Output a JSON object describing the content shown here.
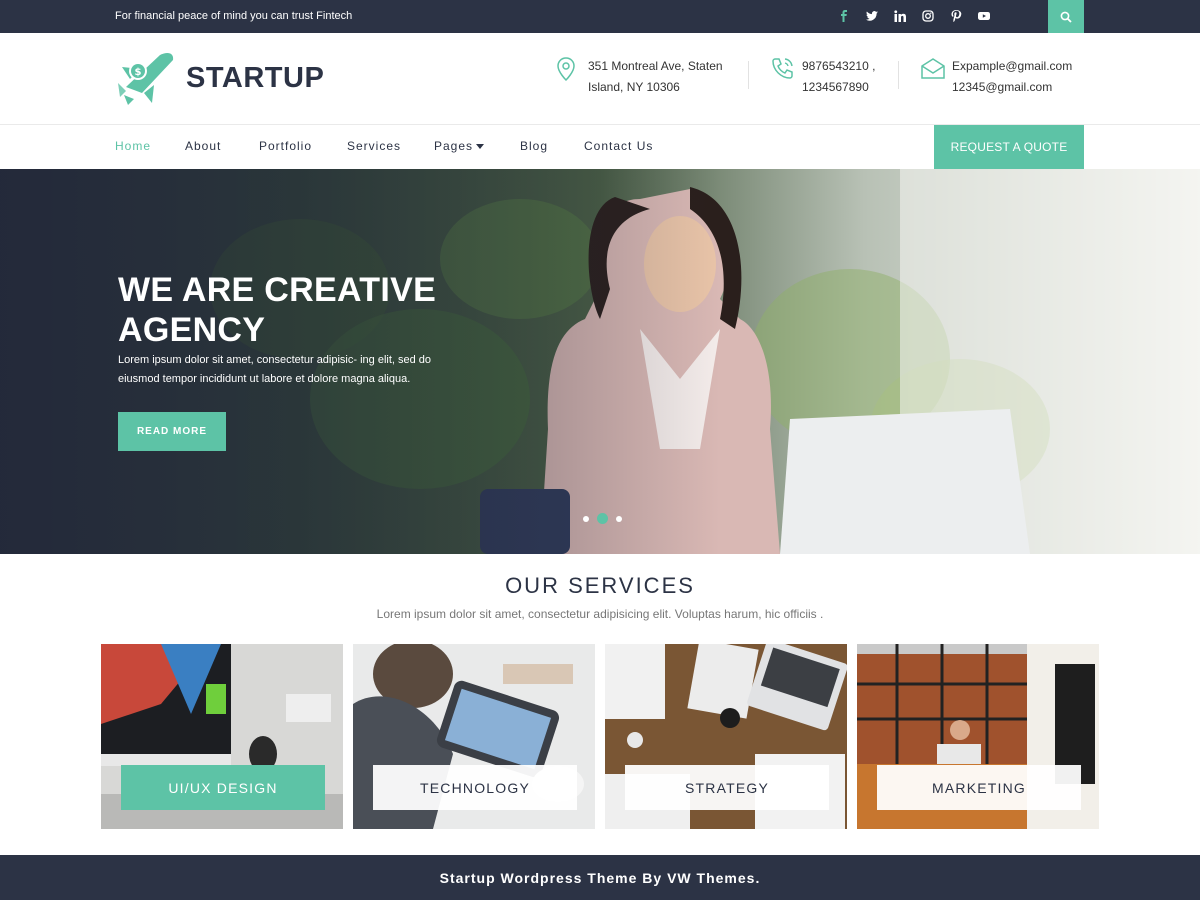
{
  "topbar": {
    "tagline": "For financial peace of mind you can trust Fintech",
    "social_icons": [
      "facebook-icon",
      "twitter-icon",
      "linkedin-icon",
      "instagram-icon",
      "pinterest-icon",
      "youtube-icon"
    ],
    "search_icon": "search-icon"
  },
  "header": {
    "logo_text": "STARTUP",
    "address": {
      "line1": "351 Montreal Ave, Staten",
      "line2": "Island, NY 10306",
      "icon": "map-pin-icon"
    },
    "phone": {
      "line1": "9876543210 ,",
      "line2": "1234567890",
      "icon": "phone-icon"
    },
    "email": {
      "line1": "Expample@gmail.com",
      "line2": "12345@gmail.com",
      "icon": "mail-icon"
    }
  },
  "nav": {
    "items": [
      "Home",
      "About",
      "Portfolio",
      "Services",
      "Pages",
      "Blog",
      "Contact Us"
    ],
    "active": "Home",
    "quote_button": "REQUEST A QUOTE"
  },
  "hero": {
    "title": "WE ARE CREATIVE AGENCY",
    "text": "Lorem ipsum dolor sit amet, consectetur adipisic- ing elit, sed do eiusmod tempor incididunt ut labore et dolore magna aliqua.",
    "button": "READ MORE",
    "slides": 3,
    "active_slide": 2
  },
  "services": {
    "title": "OUR SERVICES",
    "subtitle": "Lorem ipsum dolor sit amet, consectetur adipisicing elit. Voluptas harum, hic officiis .",
    "cards": [
      "UI/UX DESIGN",
      "TECHNOLOGY",
      "STRATEGY",
      "MARKETING"
    ]
  },
  "footer": {
    "text": "Startup Wordpress Theme By VW Themes."
  },
  "colors": {
    "accent": "#5dc3a6",
    "dark": "#2c3345",
    "white": "#ffffff"
  }
}
